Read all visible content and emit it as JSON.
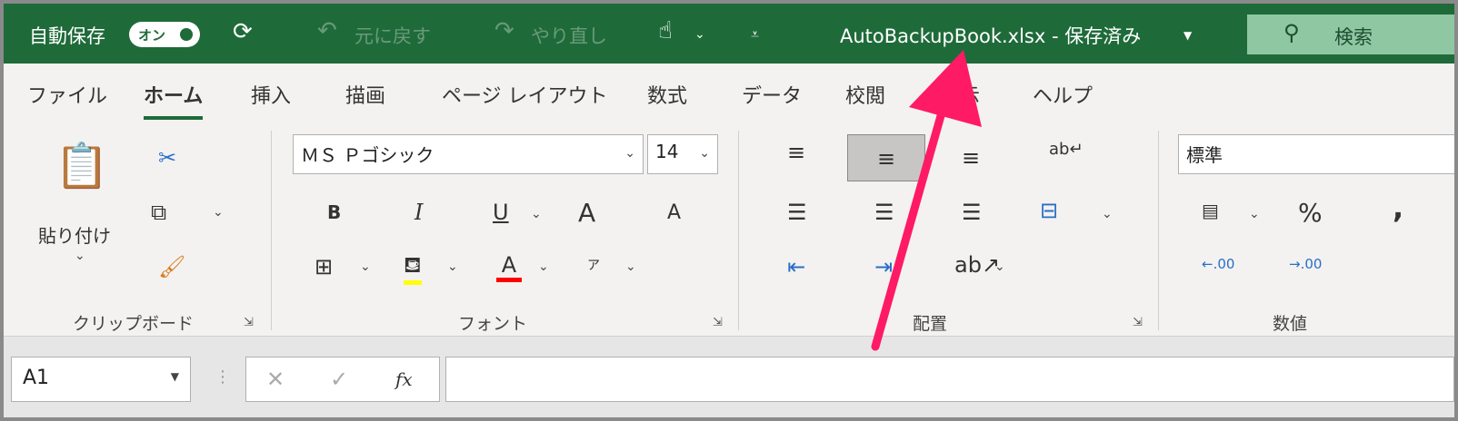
{
  "titlebar": {
    "autosave_label": "自動保存",
    "autosave_toggle": "オン",
    "autosave_on": true,
    "undo_label": "元に戻す",
    "redo_label": "やり直し",
    "file_title": "AutoBackupBook.xlsx - 保存済み",
    "search_label": "検索",
    "bg_color": "#1e6b39"
  },
  "tabs": [
    "ファイル",
    "ホーム",
    "挿入",
    "描画",
    "ページ レイアウト",
    "数式",
    "データ",
    "校閲",
    "表示",
    "ヘルプ"
  ],
  "active_tab": "ホーム",
  "ribbon": {
    "clipboard": {
      "paste_label": "貼り付け",
      "group_label": "クリップボード"
    },
    "font": {
      "font_name": "ＭＳ Ｐゴシック",
      "font_size": "14",
      "bold": "B",
      "italic": "I",
      "underline": "U",
      "grow": "A",
      "shrink": "A",
      "font_color_letter": "A",
      "phonetic": "ア",
      "group_label": "フォント",
      "highlight_color": "#ffff00",
      "font_color": "#ff0000"
    },
    "alignment": {
      "group_label": "配置"
    },
    "number": {
      "format": "標準",
      "percent": "%",
      "comma": ",",
      "group_label": "数値"
    }
  },
  "formula_bar": {
    "name_box": "A1",
    "fx": "fx",
    "value": ""
  },
  "annotation": {
    "arrow_color": "#ff1a66"
  }
}
